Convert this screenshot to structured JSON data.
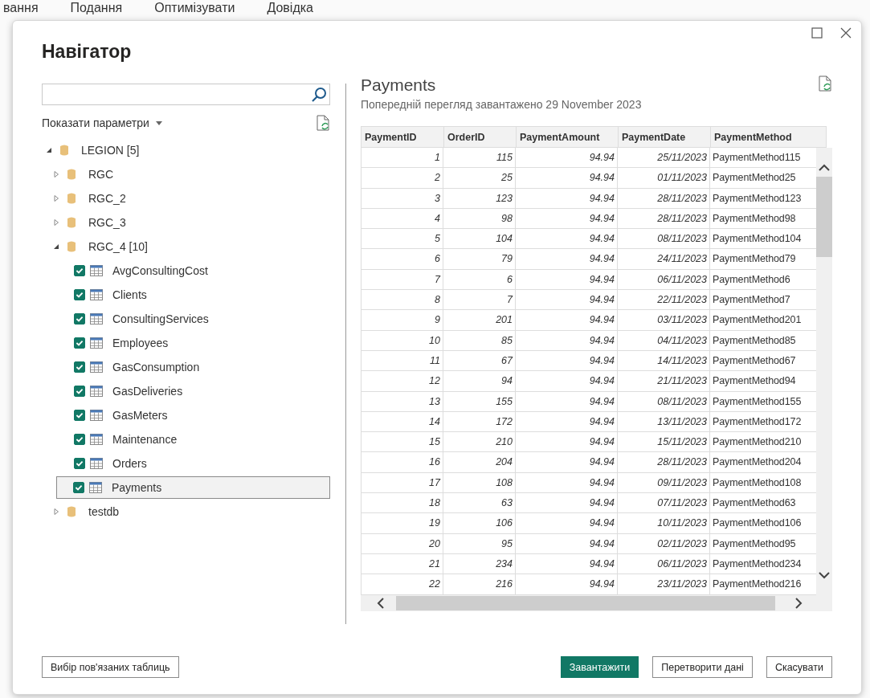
{
  "app_menu": [
    "вання",
    "Подання",
    "Оптимізувати",
    "Довідка"
  ],
  "dialog": {
    "title": "Навігатор"
  },
  "display_options": "Показати параметри",
  "tree": [
    {
      "label": "LEGION [5]",
      "kind": "database",
      "expanded": true,
      "children": [
        {
          "label": "RGC",
          "kind": "database",
          "expanded": false
        },
        {
          "label": "RGC_2",
          "kind": "database",
          "expanded": false
        },
        {
          "label": "RGC_3",
          "kind": "database",
          "expanded": false
        },
        {
          "label": "RGC_4 [10]",
          "kind": "database",
          "expanded": true,
          "children": [
            {
              "label": "AvgConsultingCost",
              "kind": "table",
              "checked": true,
              "selected": false
            },
            {
              "label": "Clients",
              "kind": "table",
              "checked": true,
              "selected": false
            },
            {
              "label": "ConsultingServices",
              "kind": "table",
              "checked": true,
              "selected": false
            },
            {
              "label": "Employees",
              "kind": "table",
              "checked": true,
              "selected": false
            },
            {
              "label": "GasConsumption",
              "kind": "table",
              "checked": true,
              "selected": false
            },
            {
              "label": "GasDeliveries",
              "kind": "table",
              "checked": true,
              "selected": false
            },
            {
              "label": "GasMeters",
              "kind": "table",
              "checked": true,
              "selected": false
            },
            {
              "label": "Maintenance",
              "kind": "table",
              "checked": true,
              "selected": false
            },
            {
              "label": "Orders",
              "kind": "table",
              "checked": true,
              "selected": false
            },
            {
              "label": "Payments",
              "kind": "table",
              "checked": true,
              "selected": true
            }
          ]
        },
        {
          "label": "testdb",
          "kind": "database",
          "expanded": false
        }
      ]
    }
  ],
  "preview": {
    "title": "Payments",
    "subtitle": "Попередній перегляд завантажено 29 November 2023",
    "columns": [
      "PaymentID",
      "OrderID",
      "PaymentAmount",
      "PaymentDate",
      "PaymentMethod"
    ],
    "rows": [
      [
        "1",
        "115",
        "94.94",
        "25/11/2023",
        "PaymentMethod115"
      ],
      [
        "2",
        "25",
        "94.94",
        "01/11/2023",
        "PaymentMethod25"
      ],
      [
        "3",
        "123",
        "94.94",
        "28/11/2023",
        "PaymentMethod123"
      ],
      [
        "4",
        "98",
        "94.94",
        "28/11/2023",
        "PaymentMethod98"
      ],
      [
        "5",
        "104",
        "94.94",
        "08/11/2023",
        "PaymentMethod104"
      ],
      [
        "6",
        "79",
        "94.94",
        "24/11/2023",
        "PaymentMethod79"
      ],
      [
        "7",
        "6",
        "94.94",
        "06/11/2023",
        "PaymentMethod6"
      ],
      [
        "8",
        "7",
        "94.94",
        "22/11/2023",
        "PaymentMethod7"
      ],
      [
        "9",
        "201",
        "94.94",
        "03/11/2023",
        "PaymentMethod201"
      ],
      [
        "10",
        "85",
        "94.94",
        "04/11/2023",
        "PaymentMethod85"
      ],
      [
        "11",
        "67",
        "94.94",
        "14/11/2023",
        "PaymentMethod67"
      ],
      [
        "12",
        "94",
        "94.94",
        "21/11/2023",
        "PaymentMethod94"
      ],
      [
        "13",
        "155",
        "94.94",
        "08/11/2023",
        "PaymentMethod155"
      ],
      [
        "14",
        "172",
        "94.94",
        "13/11/2023",
        "PaymentMethod172"
      ],
      [
        "15",
        "210",
        "94.94",
        "15/11/2023",
        "PaymentMethod210"
      ],
      [
        "16",
        "204",
        "94.94",
        "28/11/2023",
        "PaymentMethod204"
      ],
      [
        "17",
        "108",
        "94.94",
        "09/11/2023",
        "PaymentMethod108"
      ],
      [
        "18",
        "63",
        "94.94",
        "07/11/2023",
        "PaymentMethod63"
      ],
      [
        "19",
        "106",
        "94.94",
        "10/11/2023",
        "PaymentMethod106"
      ],
      [
        "20",
        "95",
        "94.94",
        "02/11/2023",
        "PaymentMethod95"
      ],
      [
        "21",
        "234",
        "94.94",
        "06/11/2023",
        "PaymentMethod234"
      ],
      [
        "22",
        "216",
        "94.94",
        "23/11/2023",
        "PaymentMethod216"
      ]
    ]
  },
  "buttons": [
    {
      "label": "Вибір пов'язаних таблиць",
      "kind": "secondary"
    },
    {
      "label": "Завантажити",
      "kind": "primary"
    },
    {
      "label": "Перетворити дані",
      "kind": "secondary"
    },
    {
      "label": "Скасувати",
      "kind": "secondary"
    }
  ]
}
